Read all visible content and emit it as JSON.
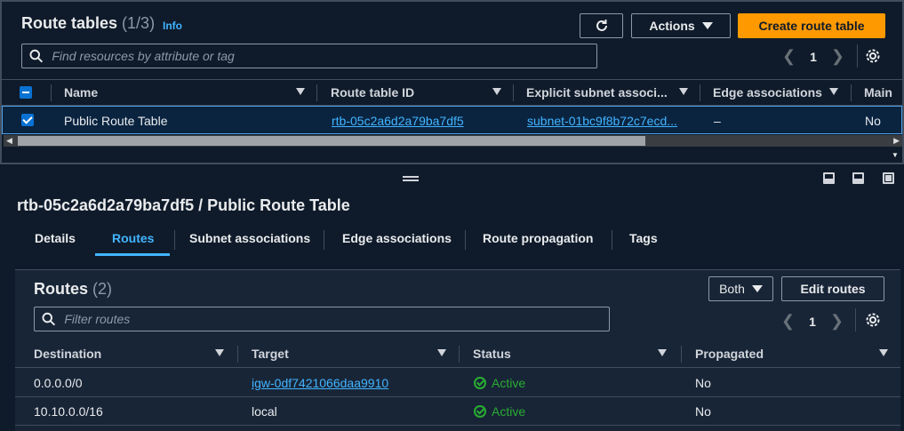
{
  "header": {
    "title": "Route tables",
    "count": "(1/3)",
    "info": "Info",
    "actions_label": "Actions",
    "create_label": "Create route table",
    "search_placeholder": "Find resources by attribute or tag",
    "page": "1"
  },
  "table": {
    "columns": [
      "Name",
      "Route table ID",
      "Explicit subnet associ...",
      "Edge associations",
      "Main"
    ],
    "rows": [
      {
        "name": "Public Route Table",
        "id": "rtb-05c2a6d2a79ba7df5",
        "subnet": "subnet-01bc9f8b72c7ecd...",
        "edge": "–",
        "main": "No",
        "selected": true
      }
    ]
  },
  "details": {
    "title": "rtb-05c2a6d2a79ba7df5 / Public Route Table",
    "tabs": [
      "Details",
      "Routes",
      "Subnet associations",
      "Edge associations",
      "Route propagation",
      "Tags"
    ],
    "active_tab": "Routes"
  },
  "routes": {
    "title": "Routes",
    "count": "(2)",
    "filter_value": "Both",
    "edit_label": "Edit routes",
    "search_placeholder": "Filter routes",
    "page": "1",
    "columns": [
      "Destination",
      "Target",
      "Status",
      "Propagated"
    ],
    "rows": [
      {
        "destination": "0.0.0.0/0",
        "target": "igw-0df7421066daa9910",
        "target_is_link": true,
        "status": "Active",
        "propagated": "No"
      },
      {
        "destination": "10.10.0.0/16",
        "target": "local",
        "target_is_link": false,
        "status": "Active",
        "propagated": "No"
      }
    ]
  },
  "colors": {
    "accent": "#ff9900",
    "link": "#42b4ff",
    "success": "#29ad32",
    "background": "#0f1b2a"
  }
}
